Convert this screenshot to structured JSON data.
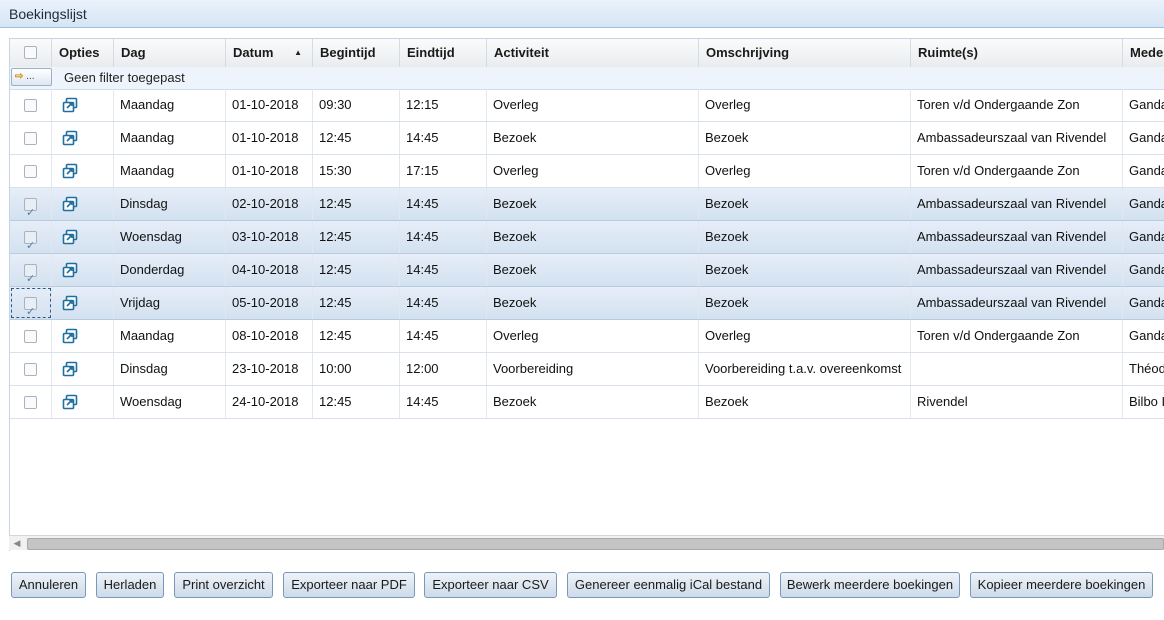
{
  "window": {
    "title": "Boekingslijst"
  },
  "grid": {
    "columns": [
      "Opties",
      "Dag",
      "Datum",
      "Begintijd",
      "Eindtijd",
      "Activiteit",
      "Omschrijving",
      "Ruimte(s)",
      "Mede"
    ],
    "sorted_column": "Datum",
    "filter_label": "Geen filter toegepast",
    "rows": [
      {
        "selected": false,
        "dag": "Maandag",
        "datum": "01-10-2018",
        "begin": "09:30",
        "eind": "12:15",
        "activiteit": "Overleg",
        "omschrijving": "Overleg",
        "ruimte": "Toren v/d Ondergaande Zon",
        "mede": "Ganda"
      },
      {
        "selected": false,
        "dag": "Maandag",
        "datum": "01-10-2018",
        "begin": "12:45",
        "eind": "14:45",
        "activiteit": "Bezoek",
        "omschrijving": "Bezoek",
        "ruimte": "Ambassadeurszaal van Rivendel",
        "mede": "Ganda"
      },
      {
        "selected": false,
        "dag": "Maandag",
        "datum": "01-10-2018",
        "begin": "15:30",
        "eind": "17:15",
        "activiteit": "Overleg",
        "omschrijving": "Overleg",
        "ruimte": "Toren v/d Ondergaande Zon",
        "mede": "Ganda"
      },
      {
        "selected": true,
        "dag": "Dinsdag",
        "datum": "02-10-2018",
        "begin": "12:45",
        "eind": "14:45",
        "activiteit": "Bezoek",
        "omschrijving": "Bezoek",
        "ruimte": "Ambassadeurszaal van Rivendel",
        "mede": "Ganda"
      },
      {
        "selected": true,
        "dag": "Woensdag",
        "datum": "03-10-2018",
        "begin": "12:45",
        "eind": "14:45",
        "activiteit": "Bezoek",
        "omschrijving": "Bezoek",
        "ruimte": "Ambassadeurszaal van Rivendel",
        "mede": "Ganda"
      },
      {
        "selected": true,
        "dag": "Donderdag",
        "datum": "04-10-2018",
        "begin": "12:45",
        "eind": "14:45",
        "activiteit": "Bezoek",
        "omschrijving": "Bezoek",
        "ruimte": "Ambassadeurszaal van Rivendel",
        "mede": "Ganda"
      },
      {
        "selected": true,
        "dag": "Vrijdag",
        "datum": "05-10-2018",
        "begin": "12:45",
        "eind": "14:45",
        "activiteit": "Bezoek",
        "omschrijving": "Bezoek",
        "ruimte": "Ambassadeurszaal van Rivendel",
        "mede": "Ganda",
        "focused": true
      },
      {
        "selected": false,
        "dag": "Maandag",
        "datum": "08-10-2018",
        "begin": "12:45",
        "eind": "14:45",
        "activiteit": "Overleg",
        "omschrijving": "Overleg",
        "ruimte": "Toren v/d Ondergaande Zon",
        "mede": "Ganda"
      },
      {
        "selected": false,
        "dag": "Dinsdag",
        "datum": "23-10-2018",
        "begin": "10:00",
        "eind": "12:00",
        "activiteit": "Voorbereiding",
        "omschrijving": "Voorbereiding t.a.v. overeenkomst",
        "ruimte": "",
        "mede": "Théod"
      },
      {
        "selected": false,
        "dag": "Woensdag",
        "datum": "24-10-2018",
        "begin": "12:45",
        "eind": "14:45",
        "activiteit": "Bezoek",
        "omschrijving": "Bezoek",
        "ruimte": "Rivendel",
        "mede": "Bilbo I"
      }
    ]
  },
  "buttons": [
    "Annuleren",
    "Herladen",
    "Print overzicht",
    "Exporteer naar PDF",
    "Exporteer naar CSV",
    "Genereer eenmalig iCal bestand",
    "Bewerk meerdere boekingen",
    "Kopieer meerdere boekingen"
  ],
  "icons": {
    "options_icon": "open-in-window-icon",
    "filter_icon": "filter-arrow-icon"
  },
  "colors": {
    "selected_row": "#d9e5f2",
    "header": "#e9ecef",
    "title_bar": "#d6e5f5",
    "icon": "#1f6fa0"
  }
}
